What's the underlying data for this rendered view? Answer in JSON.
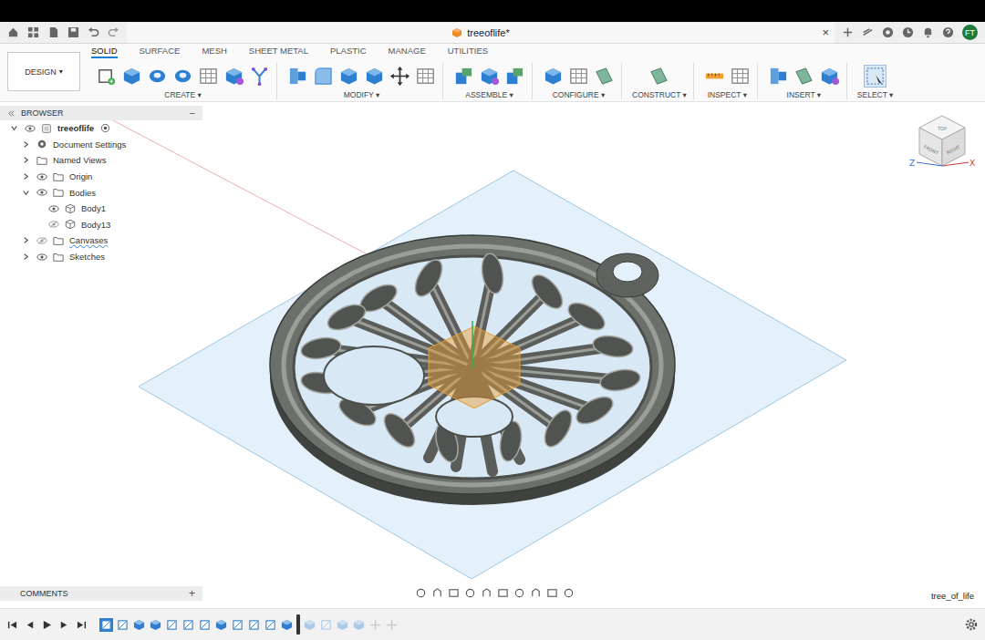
{
  "window": {
    "title": "treeoflife*",
    "close": "×",
    "user_initials": "FT"
  },
  "workspace": {
    "label": "DESIGN",
    "caret": "▾"
  },
  "ribbon_tabs": [
    {
      "label": "SOLID",
      "selected": true
    },
    {
      "label": "SURFACE",
      "selected": false
    },
    {
      "label": "MESH",
      "selected": false
    },
    {
      "label": "SHEET METAL",
      "selected": false
    },
    {
      "label": "PLASTIC",
      "selected": false
    },
    {
      "label": "MANAGE",
      "selected": false
    },
    {
      "label": "UTILITIES",
      "selected": false
    }
  ],
  "tool_caret": "▾",
  "tool_groups": [
    {
      "label": "CREATE"
    },
    {
      "label": "MODIFY"
    },
    {
      "label": "ASSEMBLE"
    },
    {
      "label": "CONFIGURE"
    },
    {
      "label": "CONSTRUCT"
    },
    {
      "label": "INSPECT"
    },
    {
      "label": "INSERT"
    },
    {
      "label": "SELECT"
    }
  ],
  "browser": {
    "title": "BROWSER",
    "collapse": "−",
    "items": [
      {
        "name": "treeoflife",
        "depth": 0,
        "kind": "component",
        "expanded": true,
        "visible": true,
        "warning": false,
        "active": true
      },
      {
        "name": "Document Settings",
        "depth": 1,
        "kind": "settings",
        "expanded": false,
        "warning": false,
        "active": false
      },
      {
        "name": "Named Views",
        "depth": 1,
        "kind": "folder",
        "expanded": false,
        "warning": false,
        "active": false
      },
      {
        "name": "Origin",
        "depth": 1,
        "kind": "folder",
        "expanded": false,
        "visible": true,
        "warning": false,
        "active": false
      },
      {
        "name": "Bodies",
        "depth": 1,
        "kind": "folder",
        "expanded": true,
        "visible": true,
        "warning": false,
        "active": false
      },
      {
        "name": "Body1",
        "depth": 2,
        "kind": "body",
        "visible": true,
        "warning": false,
        "active": false
      },
      {
        "name": "Body13",
        "depth": 2,
        "kind": "body",
        "visible": false,
        "warning": false,
        "active": false
      },
      {
        "name": "Canvases",
        "depth": 1,
        "kind": "folder",
        "expanded": false,
        "visible": false,
        "warning": true,
        "active": false
      },
      {
        "name": "Sketches",
        "depth": 1,
        "kind": "folder",
        "expanded": false,
        "visible": true,
        "warning": false,
        "active": false
      }
    ]
  },
  "comments": {
    "title": "COMMENTS",
    "add": "+"
  },
  "view_cube": {
    "top": "TOP",
    "front": "FRONT",
    "right": "RIGHT",
    "axis_left": "Z",
    "axis_right": "X"
  },
  "status_label": "tree_of_life",
  "timeline": {
    "features": [
      {
        "kind": "sketch",
        "active": true,
        "selected": true
      },
      {
        "kind": "sketch",
        "active": true,
        "selected": false
      },
      {
        "kind": "extrude",
        "active": true,
        "selected": false
      },
      {
        "kind": "extrude",
        "active": true,
        "selected": false
      },
      {
        "kind": "sketch",
        "active": true,
        "selected": false
      },
      {
        "kind": "sketch",
        "active": true,
        "selected": false
      },
      {
        "kind": "sketch",
        "active": true,
        "selected": false
      },
      {
        "kind": "extrude",
        "active": true,
        "selected": false
      },
      {
        "kind": "sketch",
        "active": true,
        "selected": false
      },
      {
        "kind": "sketch",
        "active": true,
        "selected": false
      },
      {
        "kind": "sketch",
        "active": true,
        "selected": false
      },
      {
        "kind": "extrude",
        "active": true,
        "selected": false
      },
      {
        "kind": "extrude",
        "active": false,
        "selected": false
      },
      {
        "kind": "sketch",
        "active": false,
        "selected": false
      },
      {
        "kind": "extrude",
        "active": false,
        "selected": false
      },
      {
        "kind": "extrude",
        "active": false,
        "selected": false
      },
      {
        "kind": "move",
        "active": false,
        "selected": false
      },
      {
        "kind": "move",
        "active": false,
        "selected": false
      }
    ]
  }
}
